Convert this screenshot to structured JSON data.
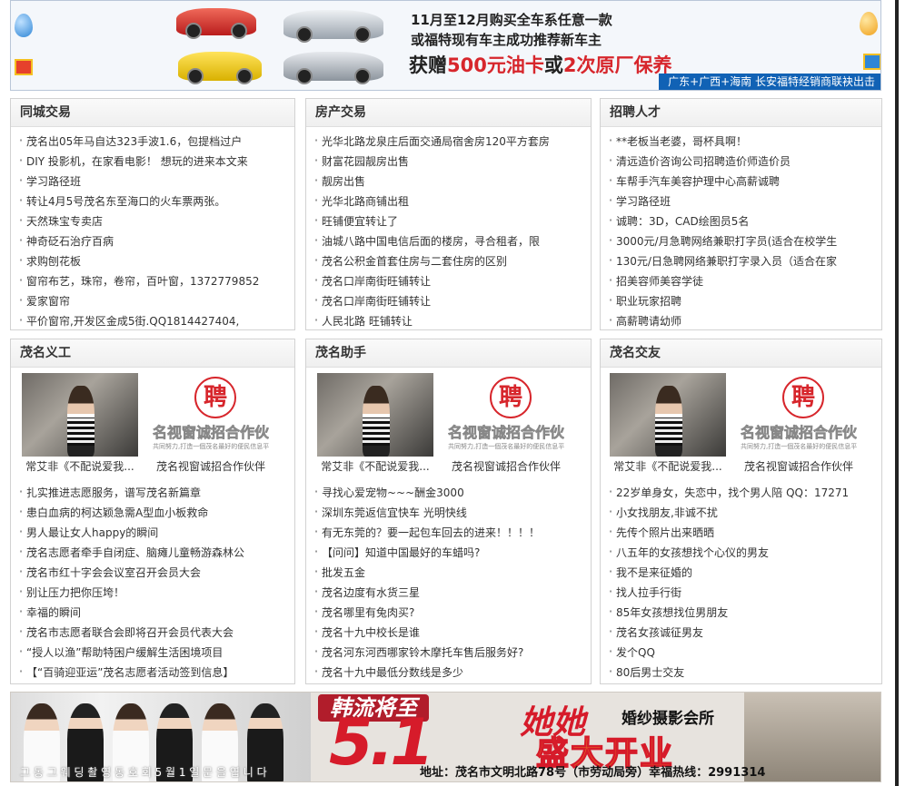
{
  "top_banner": {
    "line1": "11月至12月购买全车系任意一款",
    "line2": "或福特现有车主成功推荐新车主",
    "line3_prefix": "获赠",
    "line3_red1": "500元油卡",
    "line3_mid": "或",
    "line3_red2": "2次原厂保养",
    "footer": "广东+广西+海南   长安福特经销商联袂出击"
  },
  "panels": {
    "tongcheng": {
      "title": "同城交易",
      "items": [
        "茂名出05年马自达323手波1.6，包提档过户",
        "DIY 投影机，在家看电影！ 想玩的进来本文来",
        "学习路径班",
        "转让4月5号茂名东至海口的火车票两张。",
        "天然珠宝专卖店",
        "神奇砭石治疗百病",
        "求购刨花板",
        "窗帘布艺，珠帘，卷帘，百叶窗，1372779852",
        "爱家窗帘",
        "平价窗帘,开发区金成5街.QQ1814427404,"
      ]
    },
    "fangchan": {
      "title": "房产交易",
      "items": [
        "光华北路龙泉庄后面交通局宿舍房120平方套房",
        "财富花园靓房出售",
        "靓房出售",
        "光华北路商铺出租",
        "旺铺便宜转让了",
        "油城八路中国电信后面的楼房，寻合租者，限",
        "茂名公积金首套住房与二套住房的区别",
        "茂名口岸南街旺铺转让",
        "茂名口岸南街旺铺转让",
        "人民北路  旺铺转让"
      ]
    },
    "zhaopin": {
      "title": "招聘人才",
      "items": [
        "**老板当老婆，哥杯具啊！",
        "清远造价咨询公司招聘造价师造价员",
        "车帮手汽车美容护理中心高薪诚聘",
        "学习路径班",
        "诚聘：3D，CAD绘图员5名",
        "3000元/月急聘网络兼职打字员(适合在校学生",
        "130元/日急聘网络兼职打字录入员（适合在家",
        "招美容师美容学徒",
        "职业玩家招聘",
        "高薪聘请幼师"
      ]
    },
    "yigong": {
      "title": "茂名义工",
      "pic1_caption": "常艾非《不配说爱我...",
      "pic2_caption": "茂名视窗诚招合作伙伴",
      "items": [
        "扎实推进志愿服务，谱写茂名新篇章",
        "患白血病的柯达颖急需A型血小板救命",
        "男人最让女人happy的瞬间",
        "茂名志愿者牵手自闭症、脑瘫儿童畅游森林公",
        "茂名市红十字会会议室召开会员大会",
        "别让压力把你压垮！",
        "幸福的瞬间",
        "茂名市志愿者联合会即将召开会员代表大会",
        "“授人以渔”帮助特困户缓解生活困境项目",
        "【“百骑迎亚运”茂名志愿者活动签到信息】"
      ]
    },
    "zhushou": {
      "title": "茂名助手",
      "pic1_caption": "常艾非《不配说爱我...",
      "pic2_caption": "茂名视窗诚招合作伙伴",
      "items": [
        "寻找心爱宠物~~~酬金3000",
        "深圳东莞返信宜快车 光明快线",
        "有无东莞的？要一起包车回去的进来！！！！",
        "【问问】知道中国最好的车蜡吗?",
        "批发五金",
        "茂名边度有水货三星",
        "茂名哪里有兔肉买?",
        "茂名十九中校长是谁",
        "茂名河东河西哪家铃木摩托车售后服务好?",
        "茂名十九中最低分数线是多少"
      ]
    },
    "jiaoyou": {
      "title": "茂名交友",
      "pic1_caption": "常艾非《不配说爱我...",
      "pic2_caption": "茂名视窗诚招合作伙伴",
      "items": [
        "22岁单身女，失恋中，找个男人陪 QQ：17271",
        "小女找朋友,非诚不扰",
        "先传个照片出来晒晒",
        "八五年的女孩想找个心仪的男友",
        "我不是来征婚的",
        "找人拉手行街",
        "85年女孩想找位男朋友",
        "茂名女孩诚征男友",
        "发个QQ",
        "80后男士交友"
      ]
    }
  },
  "recruit_pic": {
    "mark": "聘",
    "big": "名视窗诚招合作伙",
    "small": "共同努力,打造一個茂名最好的便民信息平臺!"
  },
  "bottom_banner": {
    "korean_wave": "韩流将至",
    "big_number": "5.1",
    "tata": "她她",
    "studio": "婚纱摄影会所",
    "grand_opening": "盛大开业",
    "address": "地址：茂名市文明北路78号（市劳动局旁）幸福热线：2991314",
    "ghost_text": "그 동 그 웨 딩 촬 영 동 호 회 5 월 1 일 문 을 엽 니 다"
  },
  "colors": {
    "accent_red": "#d7262c",
    "banner_blue": "#1162b5",
    "panel_border": "#d2d2d2"
  }
}
